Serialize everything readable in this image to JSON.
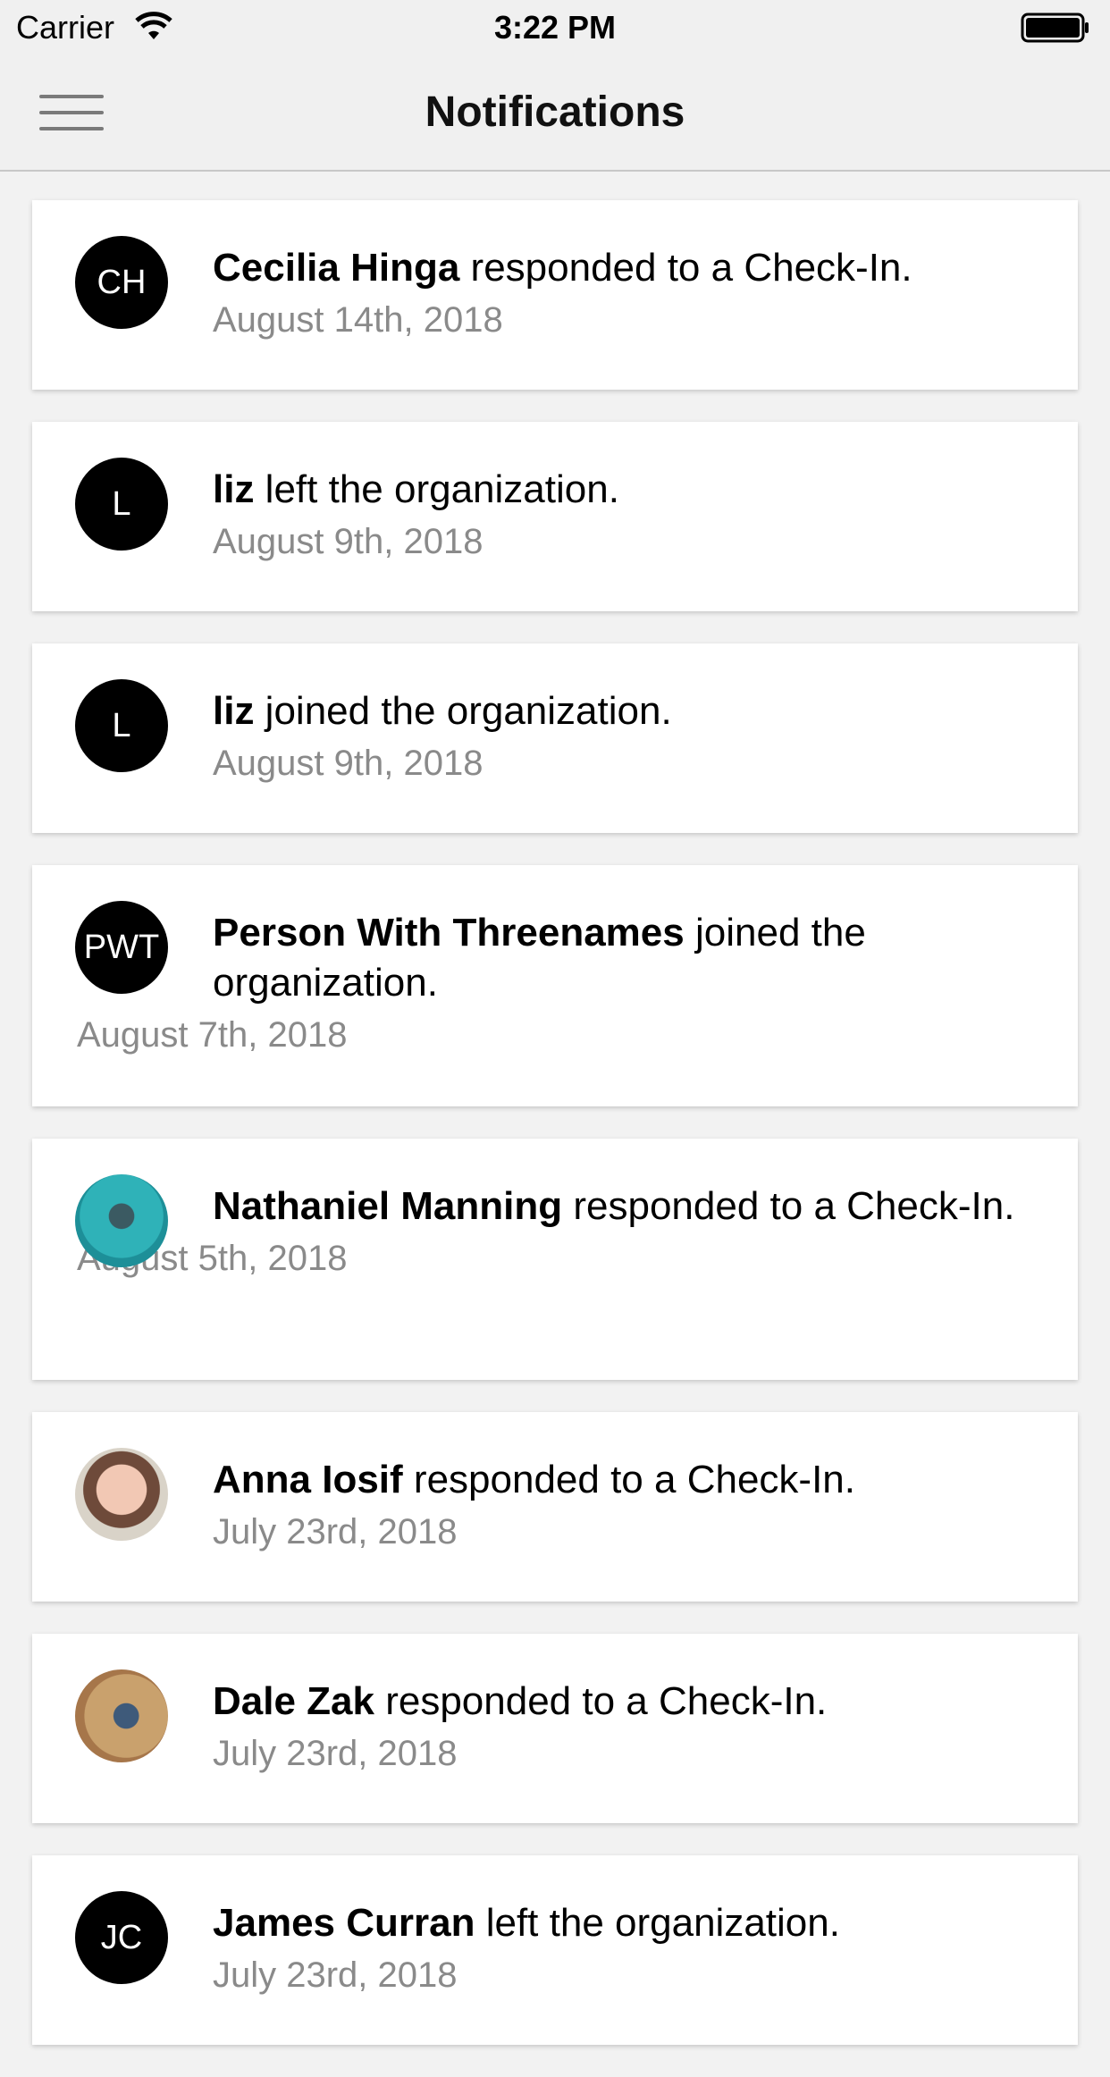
{
  "status_bar": {
    "carrier": "Carrier",
    "time": "3:22 PM"
  },
  "nav": {
    "title": "Notifications"
  },
  "notifications": [
    {
      "avatar_initials": "CH",
      "name": "Cecilia Hinga",
      "action": " responded to a Check-In.",
      "date": "August 14th, 2018"
    },
    {
      "avatar_initials": "L",
      "name": "liz",
      "action": " left the organization.",
      "date": "August 9th, 2018"
    },
    {
      "avatar_initials": "L",
      "name": "liz",
      "action": " joined the organization.",
      "date": "August 9th, 2018"
    },
    {
      "avatar_initials": "PWT",
      "name": "Person With Threenames",
      "action": " joined the organization.",
      "date": "August 7th, 2018"
    },
    {
      "avatar_initials": "",
      "name": "Nathaniel Manning",
      "action": " responded to a Check-In.",
      "date": "August 5th, 2018"
    },
    {
      "avatar_initials": "",
      "name": "Anna Iosif",
      "action": " responded to a Check-In.",
      "date": "July 23rd, 2018"
    },
    {
      "avatar_initials": "",
      "name": "Dale Zak",
      "action": " responded to a Check-In.",
      "date": "July 23rd, 2018"
    },
    {
      "avatar_initials": "JC",
      "name": "James Curran",
      "action": " left the organization.",
      "date": "July 23rd, 2018"
    }
  ]
}
